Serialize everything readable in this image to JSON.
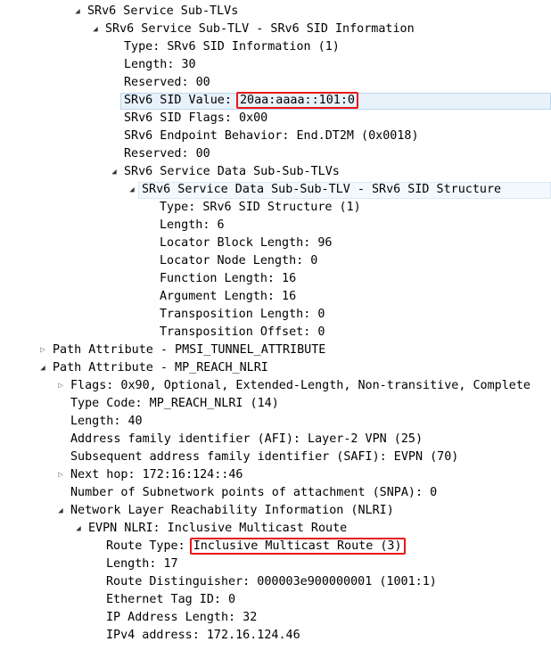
{
  "tree": {
    "rows": [
      {
        "label": "SRv6 Service Sub-TLVs"
      },
      {
        "label": "SRv6 Service Sub-TLV - SRv6 SID Information"
      },
      {
        "label": "Type: SRv6 SID Information (1)"
      },
      {
        "label": "Length: 30"
      },
      {
        "label": "Reserved: 00"
      },
      {
        "label": "SRv6 SID Value: ",
        "value": "20aa:aaaa::101:0"
      },
      {
        "label": "SRv6 SID Flags: 0x00"
      },
      {
        "label": "SRv6 Endpoint Behavior: End.DT2M (0x0018)"
      },
      {
        "label": "Reserved: 00"
      },
      {
        "label": "SRv6 Service Data Sub-Sub-TLVs"
      },
      {
        "label": "SRv6 Service Data Sub-Sub-TLV - SRv6 SID Structure"
      },
      {
        "label": "Type: SRv6 SID Structure (1)"
      },
      {
        "label": "Length: 6"
      },
      {
        "label": "Locator Block Length: 96"
      },
      {
        "label": "Locator Node Length: 0"
      },
      {
        "label": "Function Length: 16"
      },
      {
        "label": "Argument Length: 16"
      },
      {
        "label": "Transposition Length: 0"
      },
      {
        "label": "Transposition Offset: 0"
      },
      {
        "label": "Path Attribute - PMSI_TUNNEL_ATTRIBUTE"
      },
      {
        "label": "Path Attribute - MP_REACH_NLRI"
      },
      {
        "label": "Flags: 0x90, Optional, Extended-Length, Non-transitive, Complete"
      },
      {
        "label": "Type Code: MP_REACH_NLRI (14)"
      },
      {
        "label": "Length: 40"
      },
      {
        "label": "Address family identifier (AFI): Layer-2 VPN (25)"
      },
      {
        "label": "Subsequent address family identifier (SAFI): EVPN (70)"
      },
      {
        "label": "Next hop: 172:16:124::46"
      },
      {
        "label": "Number of Subnetwork points of attachment (SNPA): 0"
      },
      {
        "label": "Network Layer Reachability Information (NLRI)"
      },
      {
        "label": "EVPN NLRI: Inclusive Multicast Route"
      },
      {
        "label": "Route Type: ",
        "value": "Inclusive Multicast Route (3)"
      },
      {
        "label": "Length: 17"
      },
      {
        "label": "Route Distinguisher: 000003e900000001 (1001:1)"
      },
      {
        "label": "Ethernet Tag ID: 0"
      },
      {
        "label": "IP Address Length: 32"
      },
      {
        "label": "IPv4 address: 172.16.124.46"
      }
    ]
  },
  "colors": {
    "highlight_box": "#e8151b",
    "selected_row_bg": "#e8f2fb",
    "selected_row_border": "#bcd5ee"
  }
}
